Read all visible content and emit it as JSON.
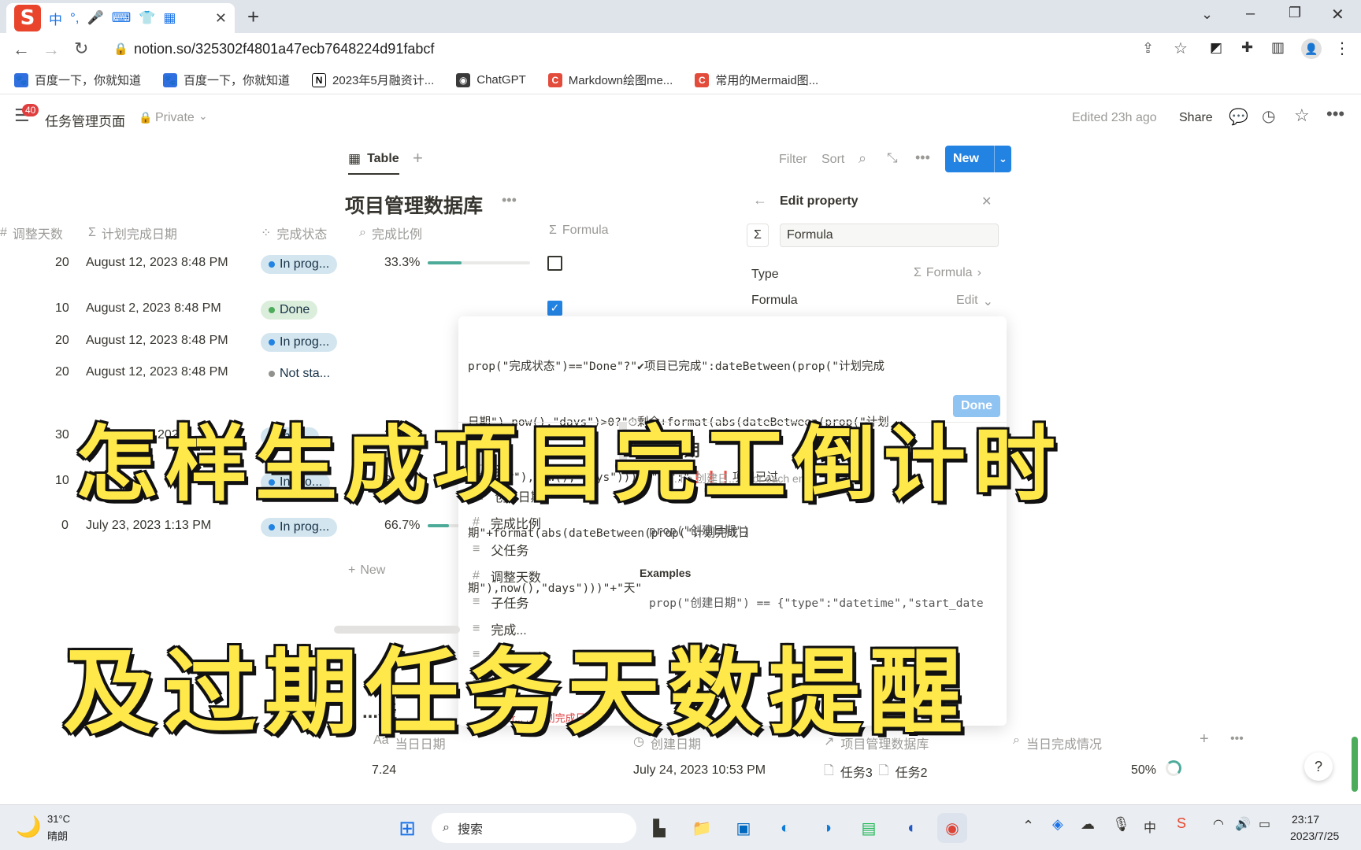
{
  "browser": {
    "ime_logo": "S",
    "ime_icons": [
      "中",
      "°,",
      "🎤",
      "⌨",
      "👕",
      "▦"
    ],
    "url": "notion.so/325302f4801a47ecb7648224d91fabcf",
    "bookmarks": [
      "百度一下，你就知道",
      "百度一下，你就知道",
      "2023年5月融资计...",
      "ChatGPT",
      "Markdown绘图me...",
      "常用的Mermaid图..."
    ]
  },
  "notion": {
    "notification_count": "40",
    "page_title": "任务管理页面",
    "privacy": "Private",
    "edited": "Edited 23h ago",
    "share": "Share",
    "view_tab": "Table",
    "toolbar": {
      "filter": "Filter",
      "sort": "Sort",
      "new": "New"
    },
    "db_title": "项目管理数据库",
    "columns": [
      "调整天数",
      "计划完成日期",
      "完成状态",
      "完成比例",
      "Formula"
    ],
    "rows": [
      {
        "days": "20",
        "date": "August 12, 2023 8:48 PM",
        "status": "In prog...",
        "pct": "33.3%",
        "progress": 0.333
      },
      {
        "days": "10",
        "date": "August 2, 2023 8:48 PM",
        "status": "Done",
        "pct": "",
        "progress": 0
      },
      {
        "days": "20",
        "date": "August 12, 2023 8:48 PM",
        "status": "In prog...",
        "pct": "",
        "progress": 0
      },
      {
        "days": "20",
        "date": "August 12, 2023 8:48 PM",
        "status": "Not sta...",
        "pct": "",
        "progress": 0
      },
      {
        "days": "30",
        "date": "...22, 2023",
        "status": "In p...",
        "pct": "33.3%",
        "progress": 0
      },
      {
        "days": "10",
        "date": "A...",
        "status": "In pro...",
        "pct": "33...",
        "progress": 0
      },
      {
        "days": "0",
        "date": "July 23, 2023 1:13 PM",
        "status": "In prog...",
        "pct": "66.7%",
        "progress": 0.667
      }
    ],
    "add_row": "New",
    "second_table": {
      "columns": [
        "当日日期",
        "创建日期",
        "项目管理数据库",
        "当日完成情况"
      ],
      "row": {
        "date": "7.24",
        "created": "July 24, 2023 10:53 PM",
        "tasks": [
          "任务3",
          "任务2"
        ],
        "pct": "50%"
      },
      "partial_title": "...表",
      "error_text": "...ax err...  ...计划完成日期..."
    }
  },
  "edit_property": {
    "title": "Edit property",
    "name_value": "Formula",
    "type_label": "Type",
    "type_value": "Formula",
    "formula_label": "Formula",
    "formula_action": "Edit"
  },
  "formula_editor": {
    "lines": [
      "prop(\"完成状态\")==\"Done\"?\"✔项目已完成\":dateBetween(prop(\"计划完成",
      "日期\"),now(),\"days\")>0?\"⏱剩余+format(abs(dateBetween(prop(\"计划",
      "完成日期\"),now(),\"days\")))\"+\"天\":\"❗❗❗项目已过",
      "期\"+format(abs(dateBetween(prop(\"计划完成日",
      "期\"),now(),\"days\")))\"+\"天\""
    ],
    "done_button": "Done",
    "properties_label": "Propert...",
    "property_list": [
      "计...",
      "创...日期",
      "完成比例",
      "父任务",
      "调整天数",
      "子任务",
      "完成...",
      "日...",
      "数..."
    ],
    "detail_title": "...期",
    "detail_desc": "...he 创建日...ty for each en...",
    "detail_syntax": "prop(\"创建日期\")",
    "examples_label": "Examples",
    "example_code": "prop(\"创建日期\") == {\"type\":\"datetime\",\"start_date"
  },
  "overlay": {
    "line1": "怎样生成项目完工倒计时",
    "line2": "及过期任务天数提醒"
  },
  "taskbar": {
    "temp": "31°C",
    "weather": "晴朗",
    "search": "搜索",
    "time": "23:17",
    "date": "2023/7/25",
    "ime": "中"
  }
}
